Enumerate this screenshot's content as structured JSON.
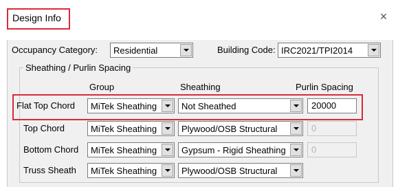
{
  "dialog": {
    "title": "Design Info",
    "close_symbol": "×"
  },
  "occupancy": {
    "label": "Occupancy Category:",
    "value": "Residential"
  },
  "building_code": {
    "label": "Building Code:",
    "value": "IRC2021/TPI2014"
  },
  "section": {
    "title": "Sheathing / Purlin Spacing",
    "headers": {
      "group": "Group",
      "sheathing": "Sheathing",
      "purlin": "Purlin Spacing"
    },
    "rows": [
      {
        "label": "Flat Top Chord",
        "group": "MiTek Sheathing",
        "sheathing": "Not Sheathed",
        "purlin": "20000",
        "purlin_enabled": true
      },
      {
        "label": "Top Chord",
        "group": "MiTek Sheathing",
        "sheathing": "Plywood/OSB Structural",
        "purlin": "0",
        "purlin_enabled": false
      },
      {
        "label": "Bottom Chord",
        "group": "MiTek Sheathing",
        "sheathing": "Gypsum - Rigid Sheathing",
        "purlin": "0",
        "purlin_enabled": false
      },
      {
        "label": "Truss Sheath",
        "group": "MiTek Sheathing",
        "sheathing": "Plywood/OSB Structural"
      }
    ]
  },
  "colors": {
    "highlight": "#d62b3b",
    "dialog_bg": "#f0f0f0"
  }
}
